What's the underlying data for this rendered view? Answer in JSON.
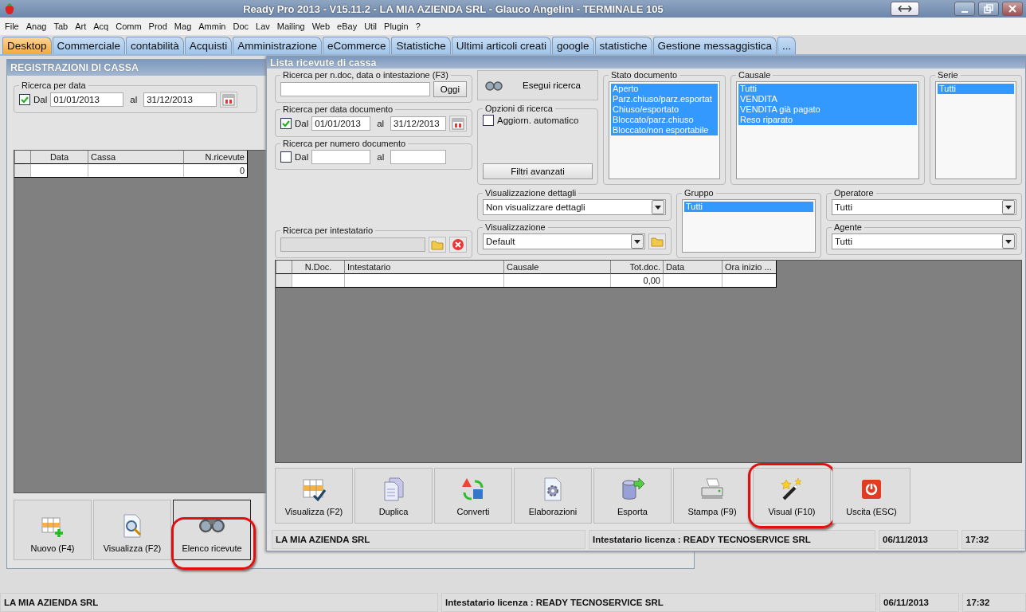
{
  "window": {
    "title": "Ready Pro 2013 - V15.11.2 - LA MIA AZIENDA SRL - Glauco Angelini - TERMINALE 105"
  },
  "menu": [
    "File",
    "Anag",
    "Tab",
    "Art",
    "Acq",
    "Comm",
    "Prod",
    "Mag",
    "Ammin",
    "Doc",
    "Lav",
    "Mailing",
    "Web",
    "eBay",
    "Util",
    "Plugin",
    "?"
  ],
  "tabs": [
    {
      "label": "Desktop",
      "selected": true
    },
    {
      "label": "Commerciale",
      "selected": false
    },
    {
      "label": "contabilità",
      "selected": false
    },
    {
      "label": "Acquisti",
      "selected": false
    },
    {
      "label": "Amministrazione",
      "selected": false
    },
    {
      "label": "eCommerce",
      "selected": false
    },
    {
      "label": "Statistiche",
      "selected": false
    },
    {
      "label": "Ultimi articoli creati",
      "selected": false
    },
    {
      "label": "google",
      "selected": false
    },
    {
      "label": "statistiche",
      "selected": false
    },
    {
      "label": "Gestione messaggistica",
      "selected": false
    },
    {
      "label": "...",
      "selected": false
    }
  ],
  "background_window": {
    "title": "REGISTRAZIONI DI CASSA",
    "date_search": {
      "legend": "Ricerca per data",
      "checkbox_label": "Dal",
      "checked": true,
      "from": "01/01/2013",
      "to_label": "al",
      "to": "31/12/2013"
    },
    "table": {
      "columns": [
        "Data",
        "Cassa",
        "N.ricevute"
      ],
      "rows": [
        [
          null,
          null,
          "0"
        ]
      ]
    },
    "buttons": [
      {
        "label": "Nuovo (F4)",
        "kind": "new",
        "highlighted": false
      },
      {
        "label": "Visualizza (F2)",
        "kind": "view",
        "highlighted": false
      },
      {
        "label": "Elenco ricevute",
        "kind": "binoculars",
        "highlighted": true
      }
    ]
  },
  "dialog": {
    "title": "Lista ricevute di cassa",
    "text_search": {
      "legend": "Ricerca per n.doc, data o intestazione (F3)",
      "button": "Oggi"
    },
    "date_search": {
      "legend": "Ricerca per data documento",
      "checkbox_label": "Dal",
      "checked": true,
      "from": "01/01/2013",
      "to_label": "al",
      "to": "31/12/2013"
    },
    "number_search": {
      "legend": "Ricerca per numero documento",
      "checkbox_label": "Dal",
      "checked": false,
      "to_label": "al"
    },
    "holder_search": {
      "legend": "Ricerca per intestatario"
    },
    "search_button": "Esegui ricerca",
    "options": {
      "legend": "Opzioni di ricerca",
      "checkbox_label": "Aggiorn. automatico",
      "checked": false,
      "button": "Filtri avanzati"
    },
    "status_list": {
      "legend": "Stato documento",
      "items": [
        {
          "label": "Aperto",
          "selected": true
        },
        {
          "label": "Parz.chiuso/parz.esportat",
          "selected": true
        },
        {
          "label": "Chiuso/esportato",
          "selected": true
        },
        {
          "label": "Bloccato/parz.chiuso",
          "selected": true
        },
        {
          "label": "Bloccato/non esportabile",
          "selected": true
        }
      ]
    },
    "reason_list": {
      "legend": "Causale",
      "items": [
        {
          "label": "Tutti",
          "selected": true
        },
        {
          "label": "VENDITA",
          "selected": true
        },
        {
          "label": "VENDITA già pagato",
          "selected": true
        },
        {
          "label": "Reso riparato",
          "selected": true
        }
      ]
    },
    "series_list": {
      "legend": "Serie",
      "items": [
        {
          "label": "Tutti",
          "selected": true
        }
      ]
    },
    "details_view": {
      "legend": "Visualizzazione dettagli",
      "value": "Non visualizzare dettagli"
    },
    "view": {
      "legend": "Visualizzazione",
      "value": "Default"
    },
    "group_list": {
      "legend": "Gruppo",
      "items": [
        {
          "label": "Tutti",
          "selected": true
        }
      ]
    },
    "operator": {
      "legend": "Operatore",
      "value": "Tutti"
    },
    "agent": {
      "legend": "Agente",
      "value": "Tutti"
    },
    "table": {
      "columns": [
        "N.Doc.",
        "Intestatario",
        "Causale",
        "Tot.doc.",
        "Data",
        "Ora inizio ..."
      ],
      "rows": [
        [
          null,
          null,
          null,
          "0,00",
          null,
          null
        ]
      ]
    },
    "buttons": [
      {
        "label": "Visualizza (F2)",
        "kind": "grid-check",
        "highlighted": false
      },
      {
        "label": "Duplica",
        "kind": "duplicate",
        "highlighted": false
      },
      {
        "label": "Converti",
        "kind": "convert",
        "highlighted": false
      },
      {
        "label": "Elaborazioni",
        "kind": "process",
        "highlighted": false
      },
      {
        "label": "Esporta",
        "kind": "export",
        "highlighted": false
      },
      {
        "label": "Stampa (F9)",
        "kind": "print",
        "highlighted": false
      },
      {
        "label": "Visual (F10)",
        "kind": "wand",
        "highlighted": true
      },
      {
        "label": "Uscita (ESC)",
        "kind": "exit",
        "highlighted": false
      }
    ],
    "status_bar": {
      "company": "LA MIA AZIENDA SRL",
      "license": "Intestatario licenza : READY TECNOSERVICE SRL",
      "date": "06/11/2013",
      "time": "17:32"
    }
  },
  "status_bar": {
    "company": "LA MIA AZIENDA SRL",
    "license": "Intestatario licenza : READY TECNOSERVICE SRL",
    "date": "06/11/2013",
    "time": "17:32"
  }
}
